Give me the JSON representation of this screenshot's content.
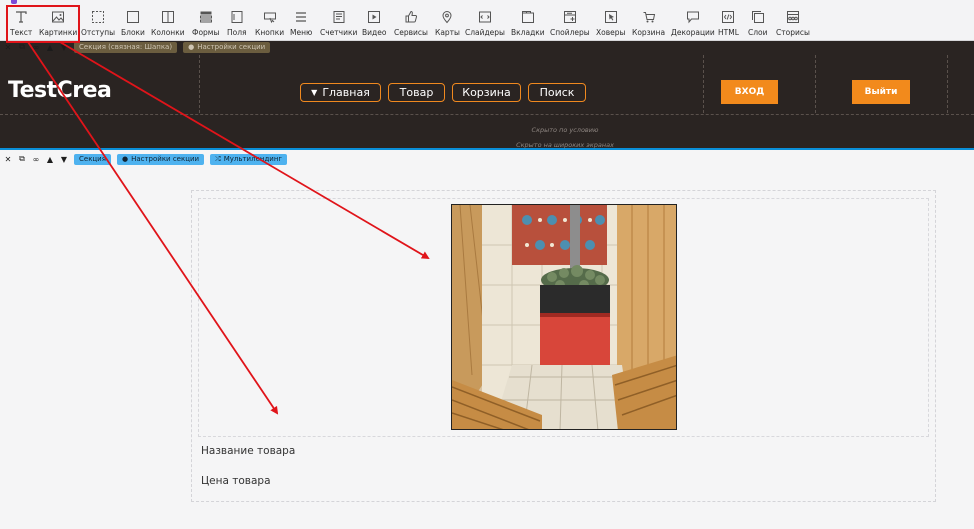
{
  "toolbar": {
    "items": [
      {
        "label": "Текст",
        "icon": "text-icon"
      },
      {
        "label": "Картинки",
        "icon": "image-icon"
      },
      {
        "label": "Отступы",
        "icon": "spacing-icon"
      },
      {
        "label": "Блоки",
        "icon": "block-icon"
      },
      {
        "label": "Колонки",
        "icon": "columns-icon"
      },
      {
        "label": "Формы",
        "icon": "form-icon"
      },
      {
        "label": "Поля",
        "icon": "field-icon"
      },
      {
        "label": "Кнопки",
        "icon": "button-icon"
      },
      {
        "label": "Меню",
        "icon": "menu-icon"
      },
      {
        "label": "Счетчики",
        "icon": "counter-icon"
      },
      {
        "label": "Видео",
        "icon": "video-icon"
      },
      {
        "label": "Сервисы",
        "icon": "like-icon"
      },
      {
        "label": "Карты",
        "icon": "map-pin-icon"
      },
      {
        "label": "Слайдеры",
        "icon": "slider-icon"
      },
      {
        "label": "Вкладки",
        "icon": "tabs-icon"
      },
      {
        "label": "Спойлеры",
        "icon": "spoiler-icon"
      },
      {
        "label": "Ховеры",
        "icon": "cursor-icon"
      },
      {
        "label": "Корзина",
        "icon": "cart-icon"
      },
      {
        "label": "Декорации",
        "icon": "speech-bubble-icon"
      },
      {
        "label": "HTML",
        "icon": "code-icon"
      },
      {
        "label": "Слои",
        "icon": "layers-icon"
      },
      {
        "label": "Сторисы",
        "icon": "stories-icon"
      }
    ]
  },
  "header_section": {
    "bar_label": "Секция (связная: Шапка)",
    "settings_label": "Настройки секции",
    "logo": "TestCrea",
    "nav": [
      "Главная",
      "Товар",
      "Корзина",
      "Поиск"
    ],
    "login_button": "ВХОД",
    "logout_button": "Выйти",
    "hidden_conditional": "Скрыто по условию",
    "hidden_wide": "Скрыто на широких экранах",
    "accent_color": "#f28a1c"
  },
  "content_section": {
    "bar_label": "Секция",
    "settings_label": "Настройки секции",
    "multilanding_label": "Мультилендинг",
    "product_name": "Название товара",
    "product_price": "Цена товара",
    "product_image": "sauna-stove-photo"
  },
  "annotation": {
    "highlight_color": "#e0141a"
  }
}
